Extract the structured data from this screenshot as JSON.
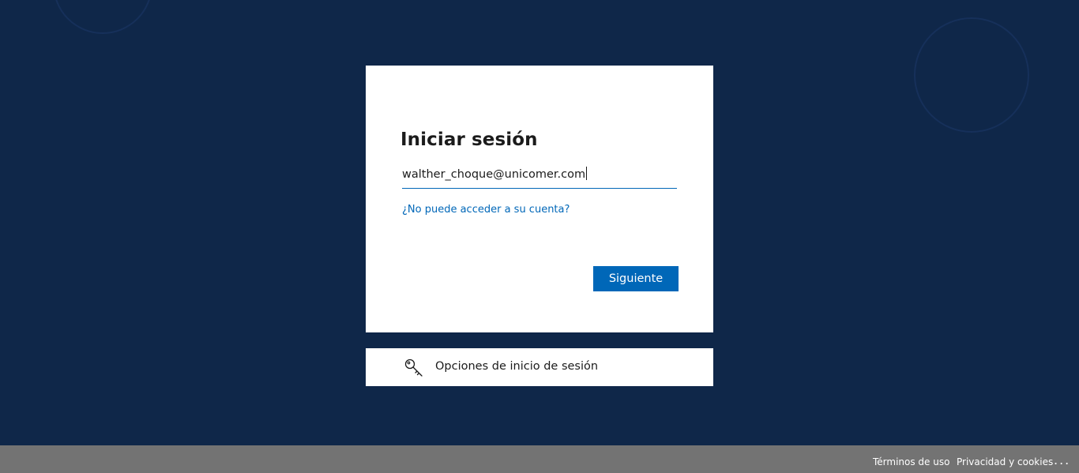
{
  "signin": {
    "title": "Iniciar sesión",
    "email_value": "walther_choque@unicomer.com",
    "cant_access_link": "¿No puede acceder a su cuenta?",
    "next_button": "Siguiente"
  },
  "signin_options": {
    "label": "Opciones de inicio de sesión",
    "icon": "key-icon"
  },
  "footer": {
    "terms": "Términos de uso",
    "privacy": "Privacidad y cookies",
    "more": "..."
  },
  "colors": {
    "background": "#0f2749",
    "accent": "#0067b8",
    "card": "#ffffff",
    "footer": "#737373"
  }
}
